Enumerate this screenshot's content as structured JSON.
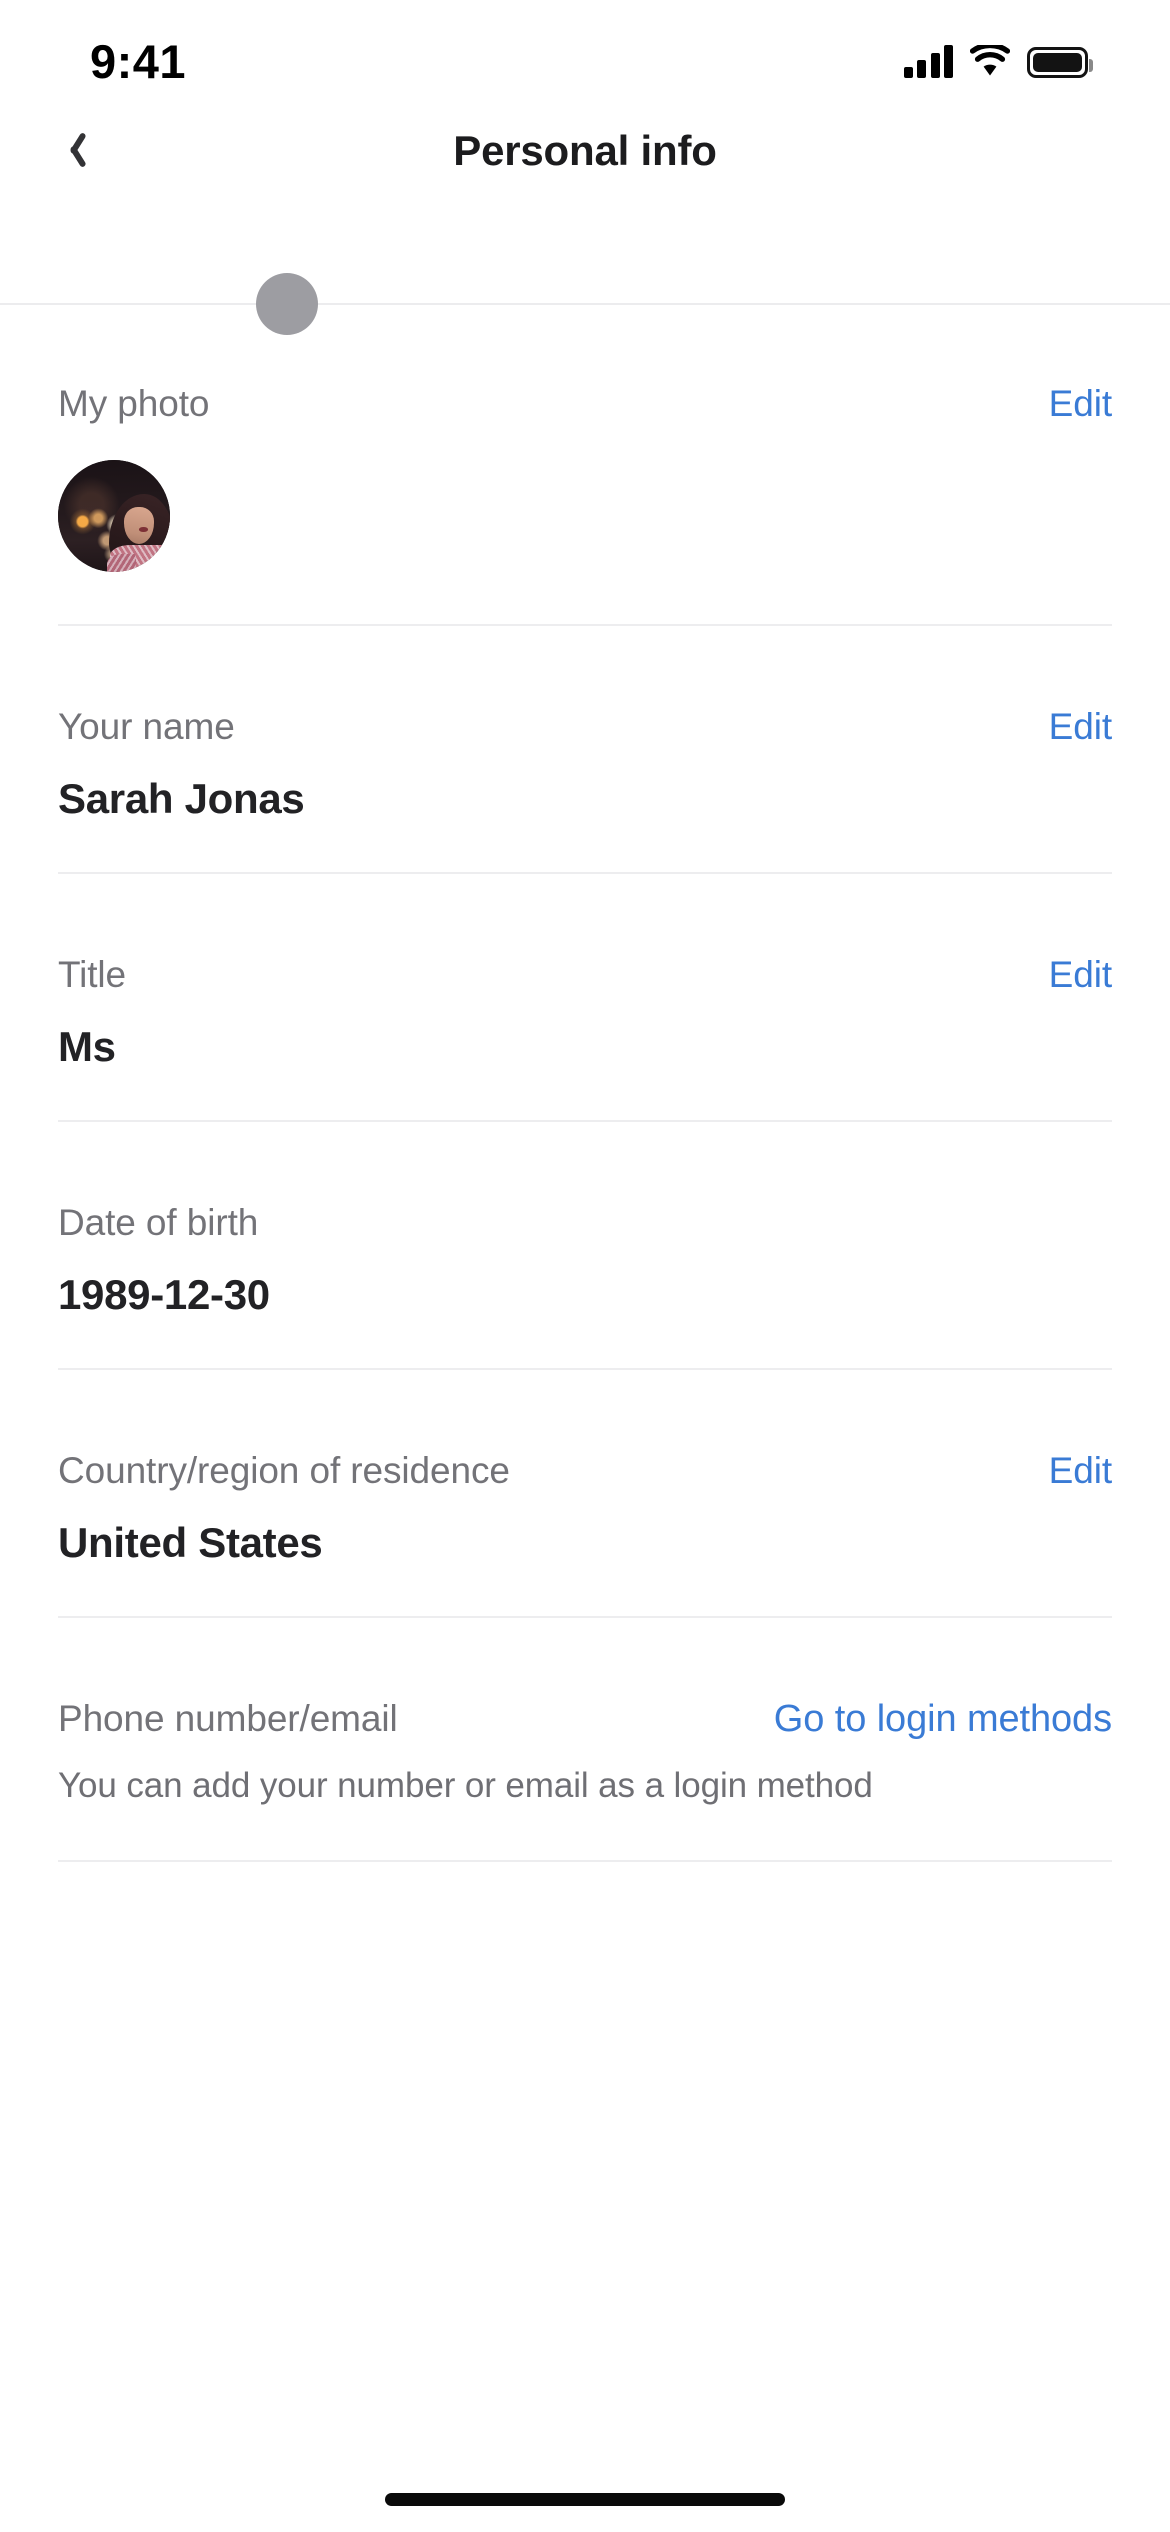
{
  "status_bar": {
    "time": "9:41",
    "signal_icon": "cellular-signal-icon",
    "wifi_icon": "wifi-icon",
    "battery_icon": "battery-full-icon"
  },
  "nav": {
    "back_icon": "chevron-left-icon",
    "title": "Personal info"
  },
  "cursor": {
    "indicator_icon": "touch-pointer-dot",
    "color": "#9a9a9f"
  },
  "theme": {
    "accent_blue": "#3a7bd5",
    "label_gray": "#737378",
    "value_black": "#222225",
    "divider": "#ededef",
    "background": "#ffffff"
  },
  "rows": [
    {
      "label": "My photo",
      "action": "Edit",
      "type": "photo",
      "avatar_alt": "profile-photo"
    },
    {
      "label": "Your name",
      "action": "Edit",
      "value": "Sarah Jonas",
      "type": "text"
    },
    {
      "label": "Title",
      "action": "Edit",
      "value": "Ms",
      "type": "text"
    },
    {
      "label": "Date of birth",
      "action": "",
      "value": "1989-12-30",
      "type": "text"
    },
    {
      "label": "Country/region of residence",
      "action": "Edit",
      "value": "United States",
      "type": "text"
    },
    {
      "label": "Phone number/email",
      "action": "Go to login methods",
      "hint": "You can add your number or email as a login method",
      "type": "hint"
    }
  ],
  "home_indicator": "home-indicator-bar"
}
